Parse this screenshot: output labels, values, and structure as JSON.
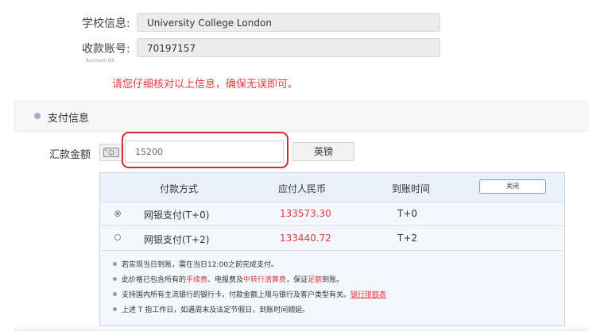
{
  "info": {
    "school_label": "学校信息:",
    "school_value": "University College London",
    "account_label": "收款账号:",
    "account_caption": "Account N0.",
    "account_value": "70197157",
    "notice": "请您仔细核对以上信息，确保无误即可。"
  },
  "payment": {
    "section_title": "支付信息",
    "amount_label": "汇款金额",
    "amount_value": "15200",
    "currency_label": "英镑",
    "table": {
      "headers": [
        "付款方式",
        "应付人民币",
        "到账时间"
      ],
      "close_label": "关闭",
      "rows": [
        {
          "method": "网银支付(T+0)",
          "rmb": "133573.30",
          "arrival": "T+0",
          "selected": true
        },
        {
          "method": "网银支付(T+2)",
          "rmb": "133440.72",
          "arrival": "T+2",
          "selected": false
        }
      ]
    },
    "notes": {
      "n1": "若实现当日到账，需在当日12:00之前完成支付。",
      "n2_a": "此价格已包含所有的",
      "n2_fee": "手续费",
      "n2_b": "、电报费及",
      "n2_clearing": "中转行清算费",
      "n2_c": "，保证",
      "n2_full": "足额",
      "n2_d": "到账。",
      "n3_a": "支持国内所有主流银行的银行卡，付款金额上限与银行及客户类型有关。",
      "n3_link": "银行限额表",
      "n4": "上述 T 指工作日，如遇周末及法定节假日，到账时间顺延。"
    }
  },
  "colors": {
    "accent_red": "#e03c3c",
    "highlight_ring": "#d42a2f",
    "table_header_bg": "#eaf0fa"
  }
}
